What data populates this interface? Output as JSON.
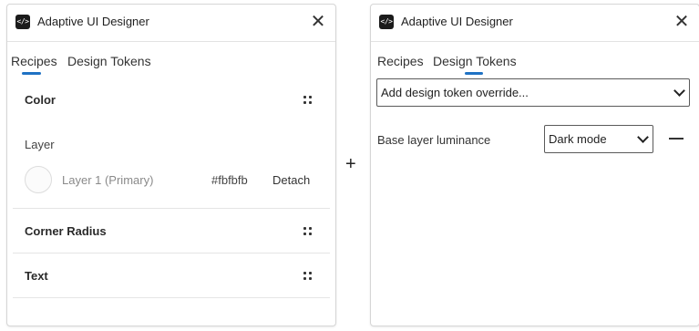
{
  "left_panel": {
    "title": "Adaptive UI Designer",
    "logo_glyph": "</>",
    "close_glyph": "✕",
    "tabs": [
      {
        "label": "Recipes",
        "active": true
      },
      {
        "label": "Design Tokens",
        "active": false
      }
    ],
    "sections": {
      "color": {
        "title": "Color",
        "layer_label": "Layer",
        "layer_name": "Layer 1 (Primary)",
        "layer_hex": "#fbfbfb",
        "detach_label": "Detach"
      },
      "corner_radius": {
        "title": "Corner Radius"
      },
      "text": {
        "title": "Text"
      }
    }
  },
  "plus_glyph": "+",
  "right_panel": {
    "title": "Adaptive UI Designer",
    "logo_glyph": "</>",
    "close_glyph": "✕",
    "tabs": [
      {
        "label": "Recipes",
        "active": false
      },
      {
        "label": "Design Tokens",
        "active": true
      }
    ],
    "add_override_select": {
      "value": "Add design token override..."
    },
    "tokens": [
      {
        "label": "Base layer luminance",
        "value": "Dark mode"
      }
    ]
  },
  "colors": {
    "accent": "#1f72c4",
    "layer_swatch": "#fbfbfb",
    "border": "#d6d6d6"
  },
  "icons": [
    "code-logo-icon",
    "close-icon",
    "drag-handle-icon",
    "chevron-down-icon",
    "plus-icon",
    "minus-icon"
  ]
}
